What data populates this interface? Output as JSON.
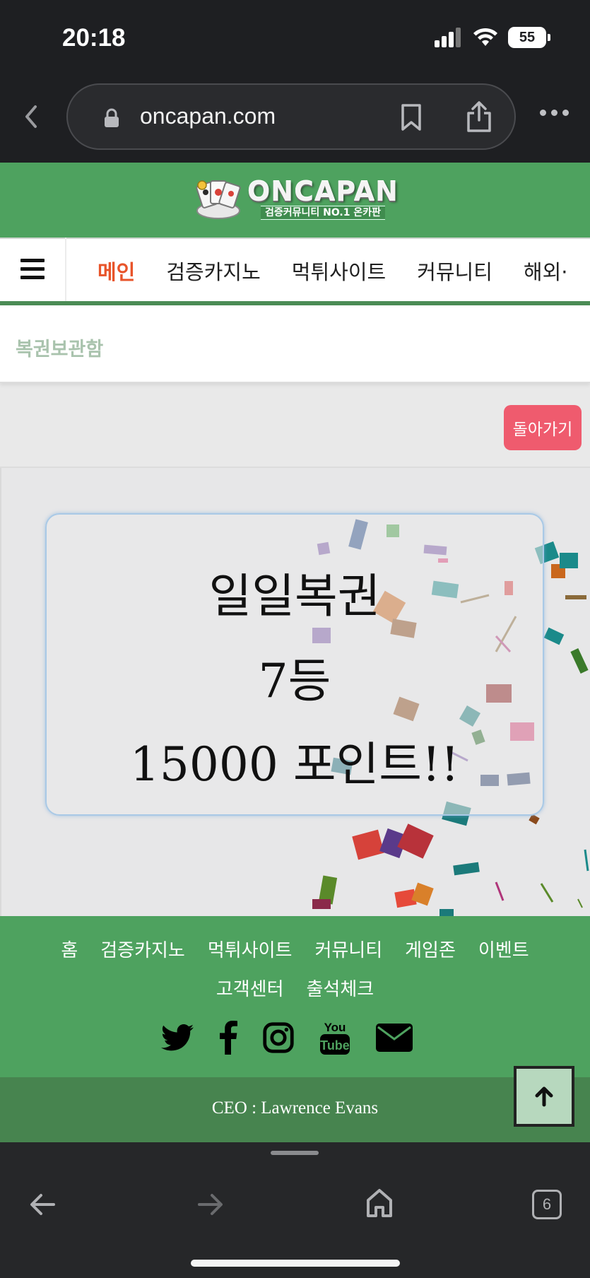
{
  "status_bar": {
    "time": "20:18",
    "battery": "55"
  },
  "browser": {
    "url": "oncapan.com",
    "tab_count": "6"
  },
  "header": {
    "logo_title": "ONCAPAN",
    "logo_subtitle": "검증커뮤니티 NO.1 온카판"
  },
  "nav": {
    "items": [
      {
        "label": "메인",
        "active": true
      },
      {
        "label": "검증카지노"
      },
      {
        "label": "먹튀사이트"
      },
      {
        "label": "커뮤니티"
      },
      {
        "label": "해외·"
      }
    ]
  },
  "breadcrumb": {
    "text": "복권보관함"
  },
  "content": {
    "back_button": "돌아가기",
    "prize": {
      "title": "일일복권",
      "rank": "7등",
      "points": "15000 포인트!!"
    }
  },
  "footer": {
    "links": [
      "홈",
      "검증카지노",
      "먹튀사이트",
      "커뮤니티",
      "게임존",
      "이벤트",
      "고객센터",
      "출석체크"
    ],
    "social": [
      "twitter-icon",
      "facebook-icon",
      "instagram-icon",
      "youtube-icon",
      "mail-icon"
    ],
    "ceo": "CEO : Lawrence Evans"
  },
  "colors": {
    "brand_green": "#4ea25f",
    "accent_orange": "#e8542a",
    "back_button": "#ef5b6e"
  }
}
